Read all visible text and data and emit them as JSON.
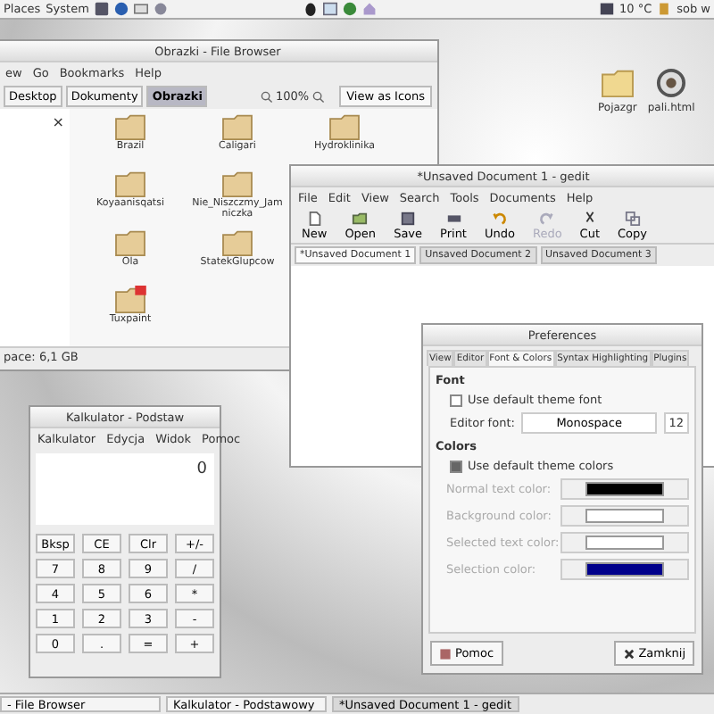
{
  "top_panel": {
    "menus": [
      "Places",
      "System"
    ],
    "weather": "10 °C",
    "clock": "sob w"
  },
  "desktop_icons": [
    {
      "label": "Pojazgr",
      "kind": "folder"
    },
    {
      "label": "pali.html",
      "kind": "file"
    }
  ],
  "file_browser": {
    "title": "Obrazki - File Browser",
    "menus": [
      "ew",
      "Go",
      "Bookmarks",
      "Help"
    ],
    "locations": [
      {
        "label": "Desktop",
        "selected": false
      },
      {
        "label": "Dokumenty",
        "selected": false
      },
      {
        "label": "Obrazki",
        "selected": true
      }
    ],
    "zoom": "100%",
    "view": "View as Icons",
    "sidebar_close": "×",
    "rows": [
      [
        {
          "label": "Brazil",
          "emblem": false
        },
        {
          "label": "Caligari",
          "emblem": false
        },
        {
          "label": "Hydroklinika",
          "emblem": false
        }
      ],
      [
        {
          "label": "Koyaanisqatsi",
          "emblem": false
        },
        {
          "label": "Nie_Niszczmy_Jamniczka",
          "emblem": false
        }
      ],
      [
        {
          "label": "Ola",
          "emblem": false
        },
        {
          "label": "StatekGlupcow",
          "emblem": false
        }
      ],
      [
        {
          "label": "Tuxpaint",
          "emblem": true
        }
      ]
    ],
    "status": "pace: 6,1 GB"
  },
  "gedit": {
    "title": "*Unsaved Document 1 - gedit",
    "menus": [
      "File",
      "Edit",
      "View",
      "Search",
      "Tools",
      "Documents",
      "Help"
    ],
    "tools": [
      {
        "label": "New",
        "kind": "new",
        "disabled": false
      },
      {
        "label": "Open",
        "kind": "open",
        "disabled": false
      },
      {
        "label": "Save",
        "kind": "save",
        "disabled": false
      },
      {
        "label": "Print",
        "kind": "print",
        "disabled": false
      },
      {
        "label": "Undo",
        "kind": "undo",
        "disabled": false
      },
      {
        "label": "Redo",
        "kind": "redo",
        "disabled": true
      },
      {
        "label": "Cut",
        "kind": "cut",
        "disabled": false
      },
      {
        "label": "Copy",
        "kind": "copy",
        "disabled": false
      }
    ],
    "tabs": [
      {
        "label": "*Unsaved Document 1",
        "selected": true
      },
      {
        "label": "Unsaved Document 2",
        "selected": false
      },
      {
        "label": "Unsaved Document 3",
        "selected": false
      }
    ]
  },
  "calculator": {
    "title": "Kalkulator - Podstaw",
    "menus": [
      "Kalkulator",
      "Edycja",
      "Widok",
      "Pomoc"
    ],
    "display": "0",
    "keys": [
      "Bksp",
      "CE",
      "Clr",
      "+/-",
      "7",
      "8",
      "9",
      "/",
      "4",
      "5",
      "6",
      "*",
      "1",
      "2",
      "3",
      "-",
      "0",
      ".",
      "=",
      "+"
    ]
  },
  "preferences": {
    "title": "Preferences",
    "tabs": [
      {
        "label": "View",
        "selected": false
      },
      {
        "label": "Editor",
        "selected": false
      },
      {
        "label": "Font & Colors",
        "selected": true
      },
      {
        "label": "Syntax Highlighting",
        "selected": false
      },
      {
        "label": "Plugins",
        "selected": false
      }
    ],
    "font_heading": "Font",
    "font_default": {
      "label": "Use default theme font",
      "checked": false
    },
    "editor_font_label": "Editor font:",
    "editor_font": "Monospace",
    "font_size": "12",
    "colors_heading": "Colors",
    "colors_default": {
      "label": "Use default theme colors",
      "checked": true
    },
    "color_rows": [
      {
        "label": "Normal text color:",
        "color": "#000000",
        "disabled": true
      },
      {
        "label": "Background color:",
        "color": "#ffffff",
        "disabled": true
      },
      {
        "label": "Selected text color:",
        "color": "#ffffff",
        "disabled": true
      },
      {
        "label": "Selection color:",
        "color": "#00008b",
        "disabled": true
      }
    ],
    "help_button": "Pomoc",
    "close_button": "Zamknij"
  },
  "taskbar": [
    {
      "label": "- File Browser",
      "selected": false
    },
    {
      "label": "Kalkulator - Podstawowy",
      "selected": false
    },
    {
      "label": "*Unsaved Document 1 - gedit",
      "selected": true
    }
  ]
}
